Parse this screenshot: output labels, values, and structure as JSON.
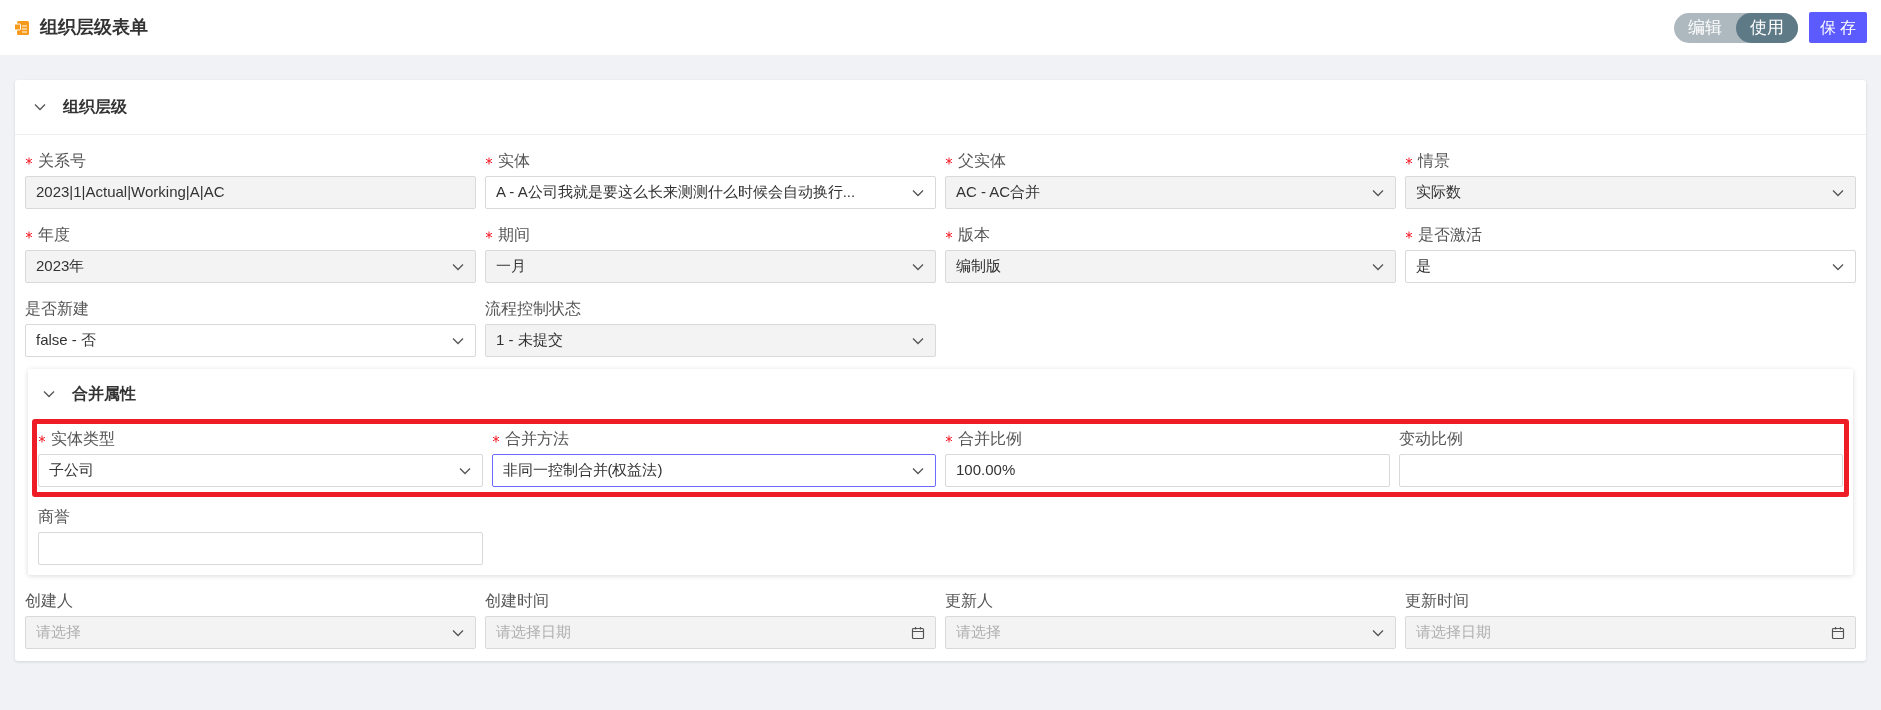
{
  "page": {
    "title": "组织层级表单"
  },
  "mode_toggle": [
    {
      "label": "编辑",
      "selected": false
    },
    {
      "label": "使用",
      "selected": true
    }
  ],
  "save_button": "保 存",
  "section": {
    "title": "组织层级",
    "expanded": true,
    "fields": [
      {
        "label": "关系号",
        "required": true,
        "kind": "input",
        "value": "2023|1|Actual|Working|A|AC",
        "disabled": true,
        "focused": false
      },
      {
        "label": "实体",
        "required": true,
        "kind": "select",
        "value": "A - A公司我就是要这么长来测测什么时候会自动换行...",
        "disabled": false,
        "focused": false
      },
      {
        "label": "父实体",
        "required": true,
        "kind": "select",
        "value": "AC - AC合并",
        "disabled": true,
        "focused": false
      },
      {
        "label": "情景",
        "required": true,
        "kind": "select",
        "value": "实际数",
        "disabled": true,
        "focused": false
      },
      {
        "label": "年度",
        "required": true,
        "kind": "select",
        "value": "2023年",
        "disabled": true,
        "focused": false
      },
      {
        "label": "期间",
        "required": true,
        "kind": "select",
        "value": "一月",
        "disabled": true,
        "focused": false
      },
      {
        "label": "版本",
        "required": true,
        "kind": "select",
        "value": "编制版",
        "disabled": true,
        "focused": false
      },
      {
        "label": "是否激活",
        "required": true,
        "kind": "select",
        "value": "是",
        "disabled": false,
        "focused": false
      },
      {
        "label": "是否新建",
        "required": false,
        "kind": "select",
        "value": "false - 否",
        "disabled": false,
        "focused": false
      },
      {
        "label": "流程控制状态",
        "required": false,
        "kind": "select",
        "value": "1 - 未提交",
        "disabled": true,
        "focused": false
      }
    ],
    "subsection": {
      "title": "合并属性",
      "expanded": true,
      "highlighted_fields": [
        {
          "label": "实体类型",
          "required": true,
          "kind": "select",
          "value": "子公司",
          "disabled": false,
          "focused": false
        },
        {
          "label": "合并方法",
          "required": true,
          "kind": "select",
          "value": "非同一控制合并(权益法)",
          "disabled": false,
          "focused": true
        },
        {
          "label": "合并比例",
          "required": true,
          "kind": "input",
          "value": "100.00%",
          "disabled": false,
          "focused": false
        },
        {
          "label": "变动比例",
          "required": false,
          "kind": "input",
          "disabled": false,
          "focused": false
        }
      ],
      "fields": [
        {
          "label": "商誉",
          "required": false,
          "kind": "input",
          "disabled": false,
          "focused": false
        }
      ]
    },
    "audit_fields": [
      {
        "label": "创建人",
        "required": false,
        "kind": "select",
        "placeholder": "请选择",
        "disabled": true,
        "focused": false
      },
      {
        "label": "创建时间",
        "required": false,
        "kind": "date",
        "placeholder": "请选择日期",
        "disabled": true,
        "focused": false
      },
      {
        "label": "更新人",
        "required": false,
        "kind": "select",
        "placeholder": "请选择",
        "disabled": true,
        "focused": false
      },
      {
        "label": "更新时间",
        "required": false,
        "kind": "date",
        "placeholder": "请选择日期",
        "disabled": true,
        "focused": false
      }
    ]
  }
}
